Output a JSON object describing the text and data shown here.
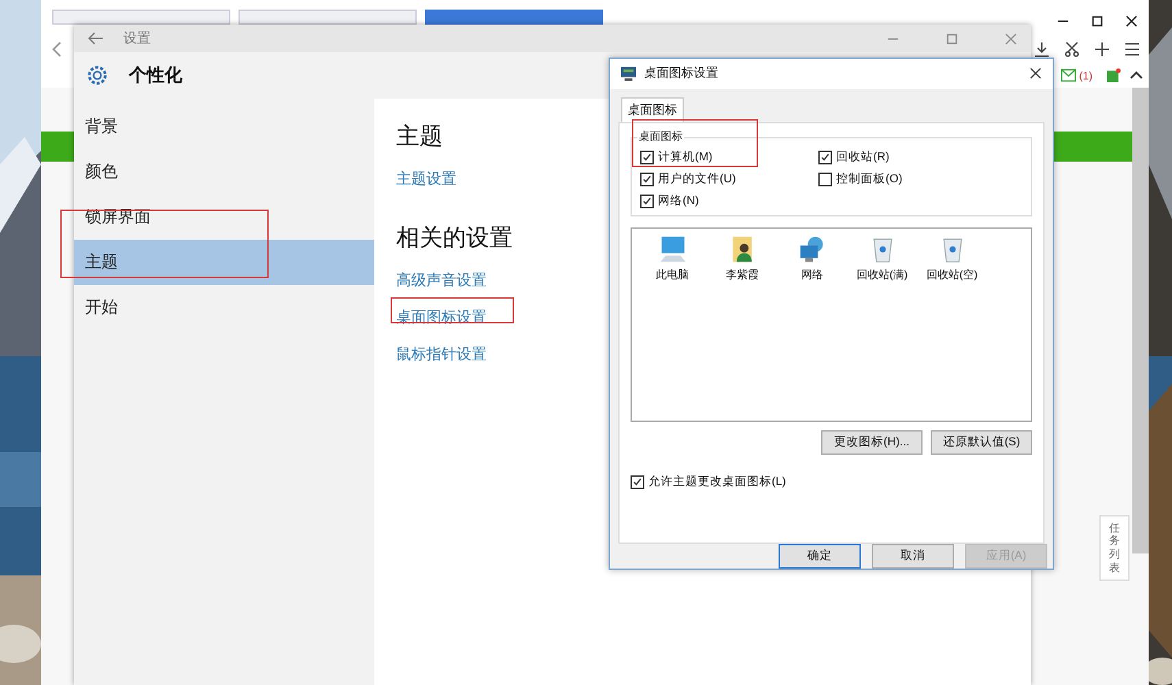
{
  "browser": {
    "tabs": [
      {
        "selected": false
      },
      {
        "selected": false
      },
      {
        "selected": true
      }
    ],
    "mail_count": "(1)",
    "side_button": "任务列表"
  },
  "settings_window": {
    "title": "设置",
    "header": "个性化",
    "nav": [
      {
        "label": "背景",
        "selected": false,
        "annotated": false
      },
      {
        "label": "颜色",
        "selected": false,
        "annotated": false
      },
      {
        "label": "锁屏界面",
        "selected": false,
        "annotated": false
      },
      {
        "label": "主题",
        "selected": true,
        "annotated": true
      },
      {
        "label": "开始",
        "selected": false,
        "annotated": false
      }
    ],
    "sections": [
      {
        "heading": "主题",
        "links": [
          {
            "label": "主题设置",
            "annotated": false
          }
        ]
      },
      {
        "heading": "相关的设置",
        "links": [
          {
            "label": "高级声音设置",
            "annotated": false
          },
          {
            "label": "桌面图标设置",
            "annotated": true
          },
          {
            "label": "鼠标指针设置",
            "annotated": false
          }
        ]
      }
    ]
  },
  "dialog": {
    "title": "桌面图标设置",
    "tabs": [
      {
        "label": "桌面图标",
        "selected": true
      }
    ],
    "group_label": "桌面图标",
    "checkboxes": [
      {
        "label": "计算机(M)",
        "checked": true,
        "annotated": true
      },
      {
        "label": "回收站(R)",
        "checked": true,
        "annotated": false
      },
      {
        "label": "用户的文件(U)",
        "checked": true,
        "annotated": false
      },
      {
        "label": "控制面板(O)",
        "checked": false,
        "annotated": false
      },
      {
        "label": "网络(N)",
        "checked": true,
        "annotated": false
      }
    ],
    "icons": [
      {
        "label": "此电脑",
        "kind": "computer",
        "selected": false
      },
      {
        "label": "李紫霞",
        "kind": "user",
        "selected": false
      },
      {
        "label": "网络",
        "kind": "network",
        "selected": false
      },
      {
        "label": "回收站(满)",
        "kind": "bin",
        "selected": false
      },
      {
        "label": "回收站(空)",
        "kind": "bin",
        "selected": false
      }
    ],
    "action_buttons": [
      "更改图标(H)...",
      "还原默认值(S)"
    ],
    "allow_theme": {
      "label": "允许主题更改桌面图标(L)",
      "checked": true
    },
    "footer_buttons": [
      {
        "label": "确定",
        "default": true,
        "disabled": false
      },
      {
        "label": "取消",
        "default": false,
        "disabled": false
      },
      {
        "label": "应用(A)",
        "default": false,
        "disabled": true
      }
    ]
  }
}
